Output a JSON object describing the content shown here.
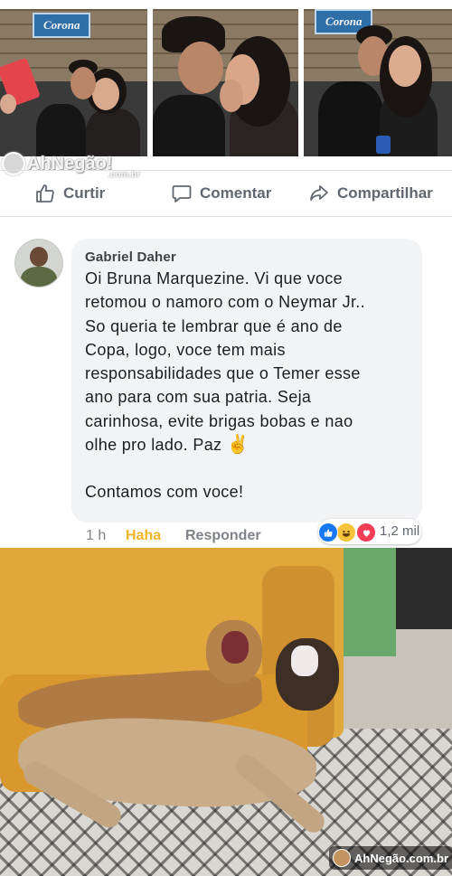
{
  "photos": {
    "sign_text": "Corona"
  },
  "watermark": {
    "brand": "AhNegão!",
    "domain": ".com.br"
  },
  "actions": {
    "like_label": "Curtir",
    "comment_label": "Comentar",
    "share_label": "Compartilhar"
  },
  "comment": {
    "author": "Gabriel Daher",
    "lines": [
      "Oi Bruna Marquezine. Vi que voce",
      "retomou o namoro com o Neymar Jr..",
      "So queria te lembrar que é ano de",
      "Copa, logo, voce tem mais",
      "responsabilidades que o Temer esse",
      "ano para com sua patria. Seja",
      "carinhosa, evite brigas bobas e nao",
      "olhe pro lado. Paz"
    ],
    "emoji": "✌",
    "closing": "Contamos com voce!",
    "time": "1 h",
    "reaction_label": "Haha",
    "reply_label": "Responder",
    "reaction_count": "1,2 mil",
    "reaction_icons": [
      "like-icon",
      "haha-icon",
      "love-icon"
    ]
  },
  "site_badge": {
    "text": "AhNegão.com.br"
  },
  "colors": {
    "like_blue": "#1877f2",
    "haha_yellow": "#f0b427",
    "love_red": "#f33e58",
    "bubble_bg": "#f2f3f5"
  }
}
